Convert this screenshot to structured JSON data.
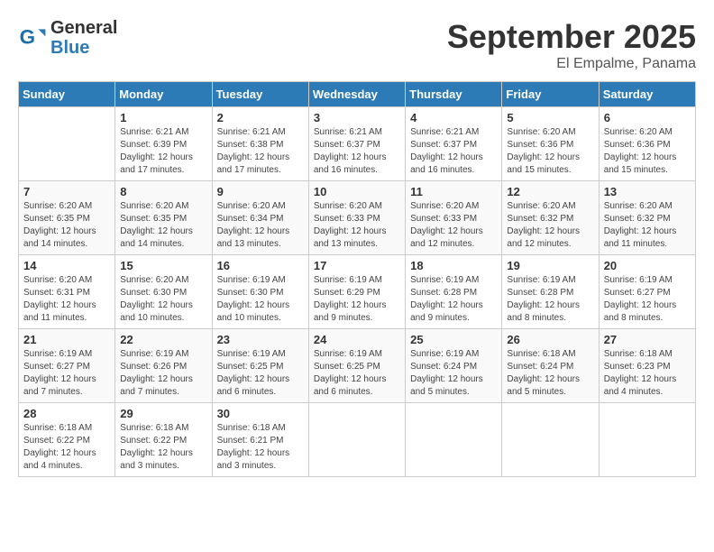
{
  "header": {
    "logo_line1": "General",
    "logo_line2": "Blue",
    "month": "September 2025",
    "location": "El Empalme, Panama"
  },
  "days_of_week": [
    "Sunday",
    "Monday",
    "Tuesday",
    "Wednesday",
    "Thursday",
    "Friday",
    "Saturday"
  ],
  "weeks": [
    [
      {
        "num": "",
        "info": ""
      },
      {
        "num": "1",
        "info": "Sunrise: 6:21 AM\nSunset: 6:39 PM\nDaylight: 12 hours\nand 17 minutes."
      },
      {
        "num": "2",
        "info": "Sunrise: 6:21 AM\nSunset: 6:38 PM\nDaylight: 12 hours\nand 17 minutes."
      },
      {
        "num": "3",
        "info": "Sunrise: 6:21 AM\nSunset: 6:37 PM\nDaylight: 12 hours\nand 16 minutes."
      },
      {
        "num": "4",
        "info": "Sunrise: 6:21 AM\nSunset: 6:37 PM\nDaylight: 12 hours\nand 16 minutes."
      },
      {
        "num": "5",
        "info": "Sunrise: 6:20 AM\nSunset: 6:36 PM\nDaylight: 12 hours\nand 15 minutes."
      },
      {
        "num": "6",
        "info": "Sunrise: 6:20 AM\nSunset: 6:36 PM\nDaylight: 12 hours\nand 15 minutes."
      }
    ],
    [
      {
        "num": "7",
        "info": "Sunrise: 6:20 AM\nSunset: 6:35 PM\nDaylight: 12 hours\nand 14 minutes."
      },
      {
        "num": "8",
        "info": "Sunrise: 6:20 AM\nSunset: 6:35 PM\nDaylight: 12 hours\nand 14 minutes."
      },
      {
        "num": "9",
        "info": "Sunrise: 6:20 AM\nSunset: 6:34 PM\nDaylight: 12 hours\nand 13 minutes."
      },
      {
        "num": "10",
        "info": "Sunrise: 6:20 AM\nSunset: 6:33 PM\nDaylight: 12 hours\nand 13 minutes."
      },
      {
        "num": "11",
        "info": "Sunrise: 6:20 AM\nSunset: 6:33 PM\nDaylight: 12 hours\nand 12 minutes."
      },
      {
        "num": "12",
        "info": "Sunrise: 6:20 AM\nSunset: 6:32 PM\nDaylight: 12 hours\nand 12 minutes."
      },
      {
        "num": "13",
        "info": "Sunrise: 6:20 AM\nSunset: 6:32 PM\nDaylight: 12 hours\nand 11 minutes."
      }
    ],
    [
      {
        "num": "14",
        "info": "Sunrise: 6:20 AM\nSunset: 6:31 PM\nDaylight: 12 hours\nand 11 minutes."
      },
      {
        "num": "15",
        "info": "Sunrise: 6:20 AM\nSunset: 6:30 PM\nDaylight: 12 hours\nand 10 minutes."
      },
      {
        "num": "16",
        "info": "Sunrise: 6:19 AM\nSunset: 6:30 PM\nDaylight: 12 hours\nand 10 minutes."
      },
      {
        "num": "17",
        "info": "Sunrise: 6:19 AM\nSunset: 6:29 PM\nDaylight: 12 hours\nand 9 minutes."
      },
      {
        "num": "18",
        "info": "Sunrise: 6:19 AM\nSunset: 6:28 PM\nDaylight: 12 hours\nand 9 minutes."
      },
      {
        "num": "19",
        "info": "Sunrise: 6:19 AM\nSunset: 6:28 PM\nDaylight: 12 hours\nand 8 minutes."
      },
      {
        "num": "20",
        "info": "Sunrise: 6:19 AM\nSunset: 6:27 PM\nDaylight: 12 hours\nand 8 minutes."
      }
    ],
    [
      {
        "num": "21",
        "info": "Sunrise: 6:19 AM\nSunset: 6:27 PM\nDaylight: 12 hours\nand 7 minutes."
      },
      {
        "num": "22",
        "info": "Sunrise: 6:19 AM\nSunset: 6:26 PM\nDaylight: 12 hours\nand 7 minutes."
      },
      {
        "num": "23",
        "info": "Sunrise: 6:19 AM\nSunset: 6:25 PM\nDaylight: 12 hours\nand 6 minutes."
      },
      {
        "num": "24",
        "info": "Sunrise: 6:19 AM\nSunset: 6:25 PM\nDaylight: 12 hours\nand 6 minutes."
      },
      {
        "num": "25",
        "info": "Sunrise: 6:19 AM\nSunset: 6:24 PM\nDaylight: 12 hours\nand 5 minutes."
      },
      {
        "num": "26",
        "info": "Sunrise: 6:18 AM\nSunset: 6:24 PM\nDaylight: 12 hours\nand 5 minutes."
      },
      {
        "num": "27",
        "info": "Sunrise: 6:18 AM\nSunset: 6:23 PM\nDaylight: 12 hours\nand 4 minutes."
      }
    ],
    [
      {
        "num": "28",
        "info": "Sunrise: 6:18 AM\nSunset: 6:22 PM\nDaylight: 12 hours\nand 4 minutes."
      },
      {
        "num": "29",
        "info": "Sunrise: 6:18 AM\nSunset: 6:22 PM\nDaylight: 12 hours\nand 3 minutes."
      },
      {
        "num": "30",
        "info": "Sunrise: 6:18 AM\nSunset: 6:21 PM\nDaylight: 12 hours\nand 3 minutes."
      },
      {
        "num": "",
        "info": ""
      },
      {
        "num": "",
        "info": ""
      },
      {
        "num": "",
        "info": ""
      },
      {
        "num": "",
        "info": ""
      }
    ]
  ]
}
